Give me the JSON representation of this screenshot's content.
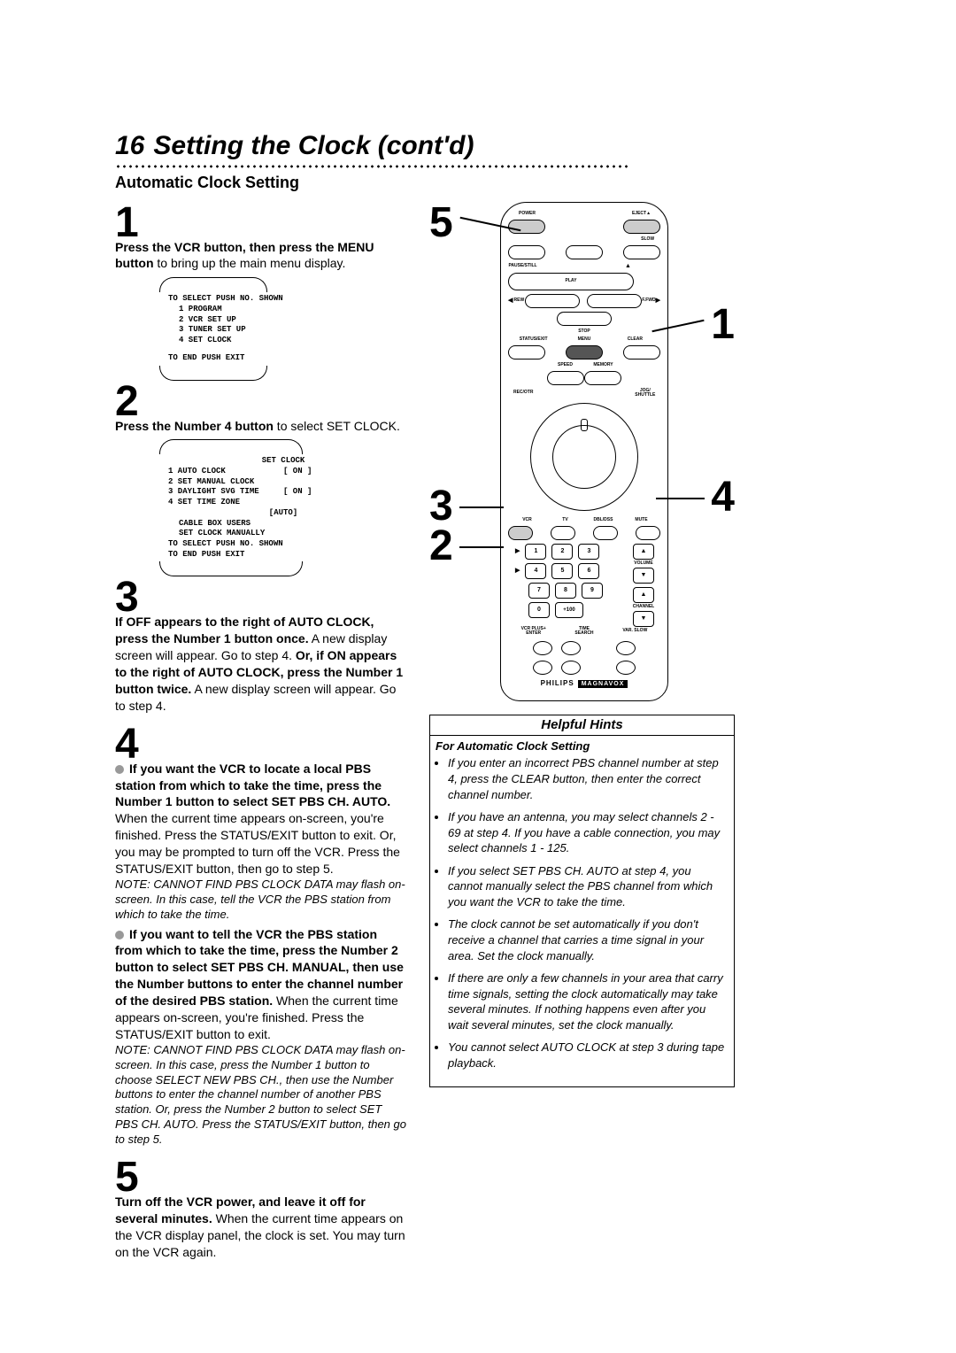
{
  "header": {
    "page_no": "16",
    "title": "Setting the Clock (cont'd)",
    "subtitle": "Automatic Clock Setting"
  },
  "steps": {
    "s1": {
      "num": "1",
      "bold_a": "Press the VCR button, then press the MENU button",
      "rest": " to bring up the main menu display."
    },
    "osd1": {
      "l1": "TO SELECT PUSH NO. SHOWN",
      "l2": "1  PROGRAM",
      "l3": "2  VCR SET UP",
      "l4": "3  TUNER SET UP",
      "l5": "4  SET CLOCK",
      "l6": "TO END PUSH EXIT"
    },
    "s2": {
      "num": "2",
      "bold_a": "Press the Number 4 button",
      "rest": " to select SET CLOCK."
    },
    "osd2": {
      "l0": "SET CLOCK",
      "l1": "1 AUTO CLOCK",
      "l1b": "[ ON ]",
      "l2": "2 SET MANUAL CLOCK",
      "l3": "3 DAYLIGHT SVG TIME",
      "l3b": "[ ON ]",
      "l4": "4 SET TIME ZONE",
      "l4b": "[AUTO]",
      "l5": "CABLE BOX USERS",
      "l6": "SET CLOCK MANUALLY",
      "l7": "TO SELECT PUSH NO. SHOWN",
      "l8": "TO END PUSH EXIT"
    },
    "s3": {
      "num": "3",
      "text_a": "If OFF appears to the right of AUTO CLOCK, press the Number 1 button once.",
      "text_b": " A new display screen will appear. Go to step 4. ",
      "text_c": "Or, if ON appears to the right of AUTO CLOCK, press the Number 1 button twice.",
      "text_d": " A new display screen will appear. Go to step 4."
    },
    "s4": {
      "num": "4",
      "a_bold": "If you want the VCR to locate a local PBS station from which to take the time, press the Number 1 button to select SET PBS CH. AUTO.",
      "a_rest": " When the current time appears on-screen, you're finished. Press the STATUS/EXIT button to exit. Or, you may be prompted to turn off the VCR. Press the STATUS/EXIT button, then go to step 5.",
      "a_note": "NOTE: CANNOT FIND PBS CLOCK DATA may flash on-screen. In this case, tell the VCR the PBS station from which to take the time.",
      "b_bold": "If you want to tell the VCR the PBS station from which to take the time, press the Number 2 button to select SET PBS CH. MANUAL, then use the Number buttons to enter the channel number of the desired PBS station.",
      "b_rest": " When the current time appears on-screen, you're finished. Press the STATUS/EXIT button to exit.",
      "b_note": "NOTE: CANNOT FIND PBS CLOCK DATA may flash on-screen. In this case, press the Number 1 button to choose SELECT NEW PBS CH., then use the Number buttons to enter the channel number of another PBS station. Or, press the Number 2 button to select SET PBS CH. AUTO. Press the STATUS/EXIT button, then go to step 5."
    },
    "s5": {
      "num": "5",
      "bold_a": "Turn off the VCR power, and leave it off for several minutes.",
      "rest": " When the current time appears on the VCR display panel, the clock is set. You may turn on the VCR again."
    }
  },
  "hints": {
    "title": "Helpful Hints",
    "sub": "For Automatic Clock Setting",
    "items": [
      "If you enter an incorrect PBS channel number at step 4, press the CLEAR button, then enter the correct channel number.",
      "If you have an antenna, you may select channels 2 - 69 at step 4. If you have a cable connection, you may select channels 1 - 125.",
      "If you select SET PBS CH. AUTO at step 4, you cannot manually select the PBS channel from which you want the VCR to take the time.",
      "The clock cannot be set automatically if you don't receive a channel that carries a time signal in your area. Set the clock manually.",
      "If there are only a few channels in your area that carry time signals, setting the clock automatically may take several minutes. If nothing happens even after you wait several minutes, set the clock manually.",
      "You cannot select AUTO CLOCK at step 3 during tape playback."
    ]
  },
  "remote": {
    "power": "POWER",
    "eject": "EJECT▲",
    "slow": "SLOW",
    "pause": "PAUSE/STILL",
    "play": "PLAY",
    "rew": "REW",
    "ffwd": "F.FWD",
    "stop": "STOP",
    "status": "STATUS/EXIT",
    "menu": "MENU",
    "clear": "CLEAR",
    "speed": "SPEED",
    "memory": "MEMORY",
    "rec": "REC/OTR",
    "jog": "JOG/\nSHUTTLE",
    "vcr": "VCR",
    "tv": "TV",
    "dbl": "DBL/DSS",
    "mute": "MUTE",
    "volume": "VOLUME",
    "channel": "CHANNEL",
    "vcrplus": "VCR PLUS+\nENTER",
    "time": "TIME\nSEARCH",
    "var": "VAR. SLOW",
    "plus100": "+100",
    "brand_a": "PHILIPS",
    "brand_b": "MAGNAVOX",
    "pt5": "5",
    "pt1": "1",
    "pt4": "4",
    "pt3": "3",
    "pt2": "2"
  }
}
